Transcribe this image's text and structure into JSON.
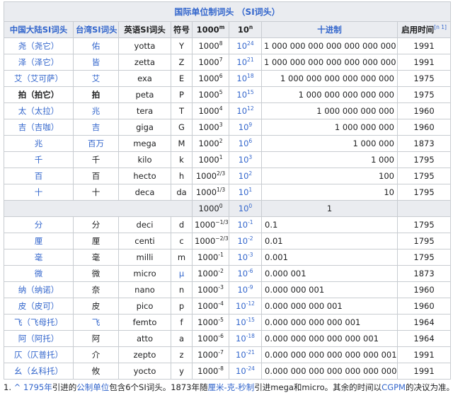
{
  "table_title": "国际单位制词头 （SI词头）",
  "headers": {
    "mainland": "中国大陆SI词头",
    "taiwan": "台湾SI词头",
    "english": "英语SI词头",
    "symbol": "符号",
    "pow1000": "1000",
    "pow1000_sup": "m",
    "pow10": "10",
    "pow10_sup": "n",
    "decimal": "十进制",
    "year": "启用时间",
    "year_note": "[n 1]"
  },
  "rows": [
    {
      "mainland": "尧（尧它）",
      "taiwan": "佑",
      "english": "yotta",
      "symbol": "Y",
      "m": "8",
      "n": "24",
      "decimal": "1 000 000 000 000 000 000 000 000",
      "year": "1991"
    },
    {
      "mainland": "泽（泽它）",
      "taiwan": "皆",
      "english": "zetta",
      "symbol": "Z",
      "m": "7",
      "n": "21",
      "decimal": "1 000 000 000 000 000 000 000",
      "year": "1991"
    },
    {
      "mainland": "艾（艾可萨）",
      "taiwan": "艾",
      "english": "exa",
      "symbol": "E",
      "m": "6",
      "n": "18",
      "decimal": "1 000 000 000 000 000 000",
      "year": "1975"
    },
    {
      "mainland": "拍（拍它）",
      "taiwan": "拍",
      "english": "peta",
      "symbol": "P",
      "m": "5",
      "n": "15",
      "decimal": "1 000 000 000 000 000",
      "year": "1975"
    },
    {
      "mainland": "太（太拉）",
      "taiwan": "兆",
      "english": "tera",
      "symbol": "T",
      "m": "4",
      "n": "12",
      "decimal": "1 000 000 000 000",
      "year": "1960"
    },
    {
      "mainland": "吉（吉咖）",
      "taiwan": "吉",
      "english": "giga",
      "symbol": "G",
      "m": "3",
      "n": "9",
      "decimal": "1 000 000 000",
      "year": "1960"
    },
    {
      "mainland": "兆",
      "taiwan": "百万",
      "english": "mega",
      "symbol": "M",
      "m": "2",
      "n": "6",
      "decimal": "1 000 000",
      "year": "1873"
    },
    {
      "mainland": "千",
      "taiwan": "千",
      "english": "kilo",
      "symbol": "k",
      "m": "1",
      "n": "3",
      "decimal": "1 000",
      "year": "1795"
    },
    {
      "mainland": "百",
      "taiwan": "百",
      "english": "hecto",
      "symbol": "h",
      "m": "2/3",
      "n": "2",
      "decimal": "100",
      "year": "1795"
    },
    {
      "mainland": "十",
      "taiwan": "十",
      "english": "deca",
      "symbol": "da",
      "m": "1/3",
      "n": "1",
      "decimal": "10",
      "year": "1795"
    }
  ],
  "unit_row": {
    "m": "0",
    "n": "0",
    "decimal": "1"
  },
  "lower_rows": [
    {
      "mainland": "分",
      "taiwan": "分",
      "english": "deci",
      "symbol": "d",
      "m": "−1/3",
      "n": "-1",
      "decimal": "0.1",
      "year": "1795"
    },
    {
      "mainland": "厘",
      "taiwan": "厘",
      "english": "centi",
      "symbol": "c",
      "m": "−2/3",
      "n": "-2",
      "decimal": "0.01",
      "year": "1795"
    },
    {
      "mainland": "毫",
      "taiwan": "毫",
      "english": "milli",
      "symbol": "m",
      "m": "-1",
      "n": "-3",
      "decimal": "0.001",
      "year": "1795"
    },
    {
      "mainland": "微",
      "taiwan": "微",
      "english": "micro",
      "symbol": "μ",
      "m": "-2",
      "n": "-6",
      "decimal": "0.000 001",
      "year": "1873"
    },
    {
      "mainland": "纳（纳诺）",
      "taiwan": "奈",
      "english": "nano",
      "symbol": "n",
      "m": "-3",
      "n": "-9",
      "decimal": "0.000 000 001",
      "year": "1960"
    },
    {
      "mainland": "皮（皮可）",
      "taiwan": "皮",
      "english": "pico",
      "symbol": "p",
      "m": "-4",
      "n": "-12",
      "decimal": "0.000 000 000 001",
      "year": "1960"
    },
    {
      "mainland": "飞（飞母托）",
      "taiwan": "飞",
      "english": "femto",
      "symbol": "f",
      "m": "-5",
      "n": "-15",
      "decimal": "0.000 000 000 000 001",
      "year": "1964"
    },
    {
      "mainland": "阿（阿托）",
      "taiwan": "阿",
      "english": "atto",
      "symbol": "a",
      "m": "-6",
      "n": "-18",
      "decimal": "0.000 000 000 000 000 001",
      "year": "1964"
    },
    {
      "mainland": "仄（仄普托）",
      "taiwan": "介",
      "english": "zepto",
      "symbol": "z",
      "m": "-7",
      "n": "-21",
      "decimal": "0.000 000 000 000 000 000 001",
      "year": "1991"
    },
    {
      "mainland": "幺（幺科托）",
      "taiwan": "攸",
      "english": "yocto",
      "symbol": "y",
      "m": "-8",
      "n": "-24",
      "decimal": "0.000 000 000 000 000 000 000 001",
      "year": "1991"
    }
  ],
  "footnote": {
    "number": "1.",
    "caret": "^",
    "year_link": "1795年",
    "text1": "引进的",
    "link1": "公制单位",
    "text2": "包含6个SI词头。1873年随",
    "link2": "厘米-克-秒制",
    "text3": "引进mega和micro。其余的时间以",
    "link3": "CGPM",
    "text4": "的决议为准。"
  },
  "colors": {
    "link": "#3366cc",
    "header_bg": "#eaecf0",
    "border": "#c8ccd1"
  }
}
